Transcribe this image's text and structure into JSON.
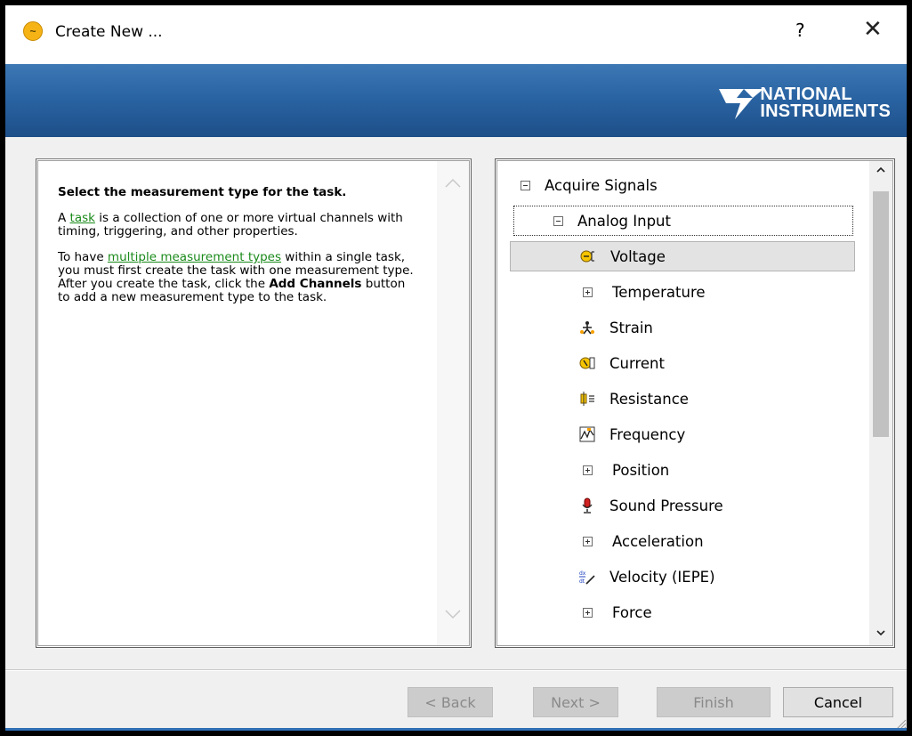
{
  "window": {
    "title": "Create New ...",
    "help_label": "?",
    "close_label": "✕"
  },
  "banner": {
    "logo_line1": "NATIONAL",
    "logo_line2": "INSTRUMENTS"
  },
  "info": {
    "heading": "Select the measurement type for the task.",
    "p1_pre": "A ",
    "p1_link": "task",
    "p1_post": " is a collection of one or more virtual channels with timing, triggering, and other properties.",
    "p2_pre": "To have ",
    "p2_link": "multiple measurement types",
    "p2_mid": " within a single task, you must first create the task with one measurement type. After you create the task, click the ",
    "p2_bold": "Add Channels",
    "p2_post": " button to add a new measurement type to the task."
  },
  "tree": {
    "root": "Acquire Signals",
    "group": "Analog Input",
    "items": [
      {
        "label": "Voltage",
        "icon": "voltage-icon",
        "expandable": false,
        "selected": true
      },
      {
        "label": "Temperature",
        "icon": "expand-icon",
        "expandable": true
      },
      {
        "label": "Strain",
        "icon": "strain-icon",
        "expandable": false
      },
      {
        "label": "Current",
        "icon": "current-icon",
        "expandable": false
      },
      {
        "label": "Resistance",
        "icon": "resistance-icon",
        "expandable": false
      },
      {
        "label": "Frequency",
        "icon": "frequency-icon",
        "expandable": false
      },
      {
        "label": "Position",
        "icon": "expand-icon",
        "expandable": true
      },
      {
        "label": "Sound Pressure",
        "icon": "microphone-icon",
        "expandable": false
      },
      {
        "label": "Acceleration",
        "icon": "expand-icon",
        "expandable": true
      },
      {
        "label": "Velocity (IEPE)",
        "icon": "velocity-icon",
        "expandable": false
      },
      {
        "label": "Force",
        "icon": "expand-icon",
        "expandable": true
      }
    ]
  },
  "buttons": {
    "back": "< Back",
    "next": "Next >",
    "finish": "Finish",
    "cancel": "Cancel"
  },
  "colors": {
    "banner": "#2a64a3",
    "link": "#1a8a1a",
    "selection": "#e3e3e3"
  }
}
